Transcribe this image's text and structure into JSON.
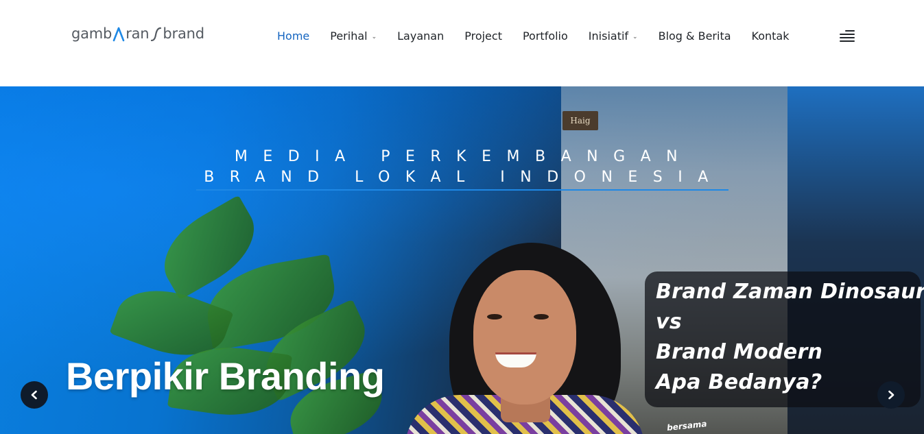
{
  "header": {
    "logo_parts": [
      "gamb",
      "ran",
      "brand"
    ],
    "nav": [
      {
        "label": "Home",
        "active": true,
        "dropdown": false
      },
      {
        "label": "Perihal",
        "active": false,
        "dropdown": true
      },
      {
        "label": "Layanan",
        "active": false,
        "dropdown": false
      },
      {
        "label": "Project",
        "active": false,
        "dropdown": false
      },
      {
        "label": "Portfolio",
        "active": false,
        "dropdown": false
      },
      {
        "label": "Inisiatif",
        "active": false,
        "dropdown": true
      },
      {
        "label": "Blog & Berita",
        "active": false,
        "dropdown": false
      },
      {
        "label": "Kontak",
        "active": false,
        "dropdown": false
      }
    ],
    "menu_icon": "hamburger-menu-icon"
  },
  "hero": {
    "tagline_line1": "MEDIA PERKEMBANGAN",
    "tagline_line2": "BRAND LOKAL INDONESIA",
    "title": "Berpikir Branding",
    "callout": "Brand Zaman Dinosaurus\nvs\nBrand Modern\nApa Bedanya?",
    "callout_sub": "bersama",
    "poster_label": "Haig",
    "prev_icon": "chevron-left-icon",
    "next_icon": "chevron-right-icon"
  },
  "colors": {
    "accent": "#1565c0",
    "hero_blue": "#0a7fe0",
    "nav_text": "#1f2328"
  }
}
